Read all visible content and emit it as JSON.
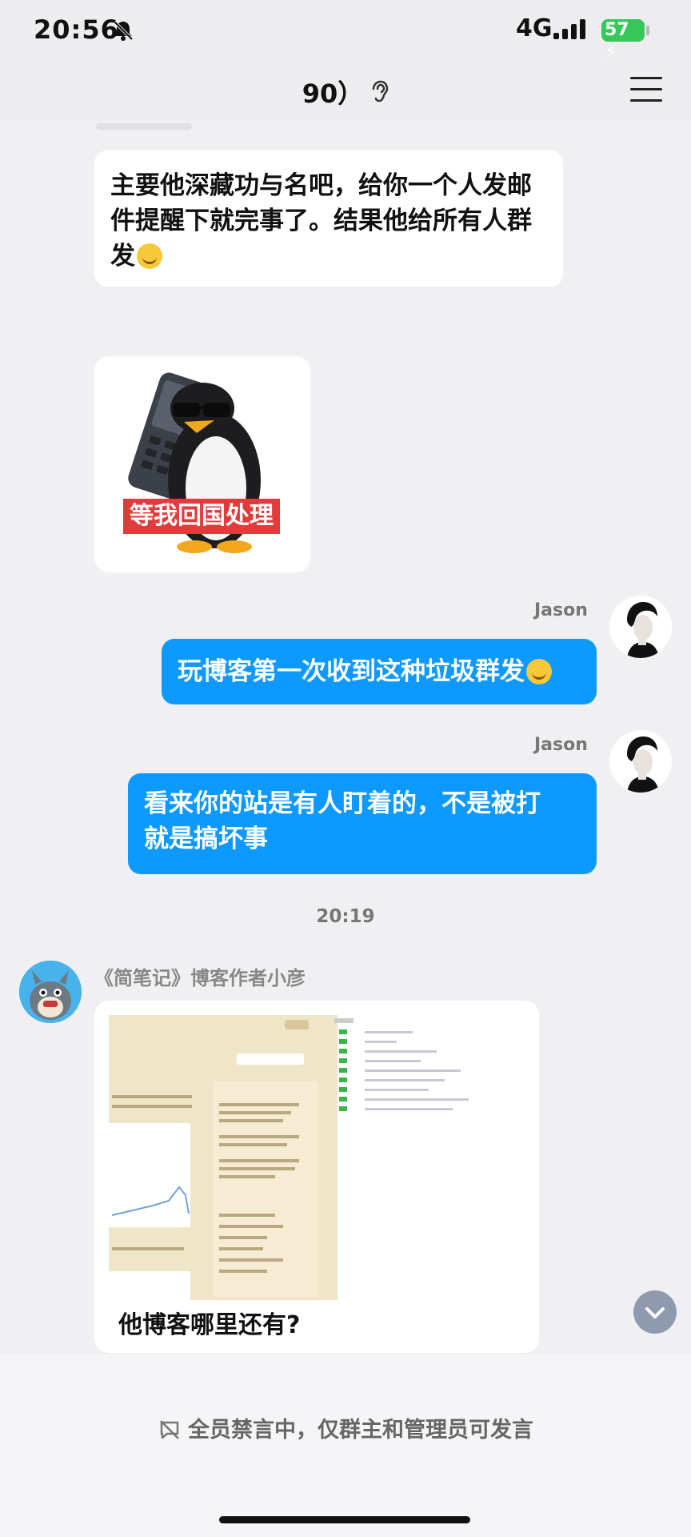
{
  "status_bar": {
    "time": "20:56",
    "network": "4G",
    "battery": "57"
  },
  "header": {
    "title": "90）"
  },
  "messages": [
    {
      "text": "主要他深藏功与名吧，给你一个人发邮件提醒下就完事了。结果他给所有人群发"
    },
    {
      "sticker_text": "等我回国处理"
    },
    {
      "sender": "Jason",
      "text": "玩博客第一次收到这种垃圾群发"
    },
    {
      "sender": "Jason",
      "text_line1": "看来你的站是有人盯着的，不是被打",
      "text_line2": "就是搞坏事"
    }
  ],
  "timestamp": "20:19",
  "group_message": {
    "sender": "《简笔记》博客作者小彦",
    "caption": "他博客哪里还有?"
  },
  "footer": {
    "mute_notice": "全员禁言中，仅群主和管理员可发言"
  },
  "colors": {
    "accent_blue": "#0d99ff",
    "background": "#f0f0f3",
    "battery_green": "#35c759"
  },
  "icons": [
    "bell-muted-icon",
    "signal-icon",
    "battery-icon",
    "ear-icon",
    "menu-icon",
    "chevron-down-icon",
    "mute-icon"
  ]
}
